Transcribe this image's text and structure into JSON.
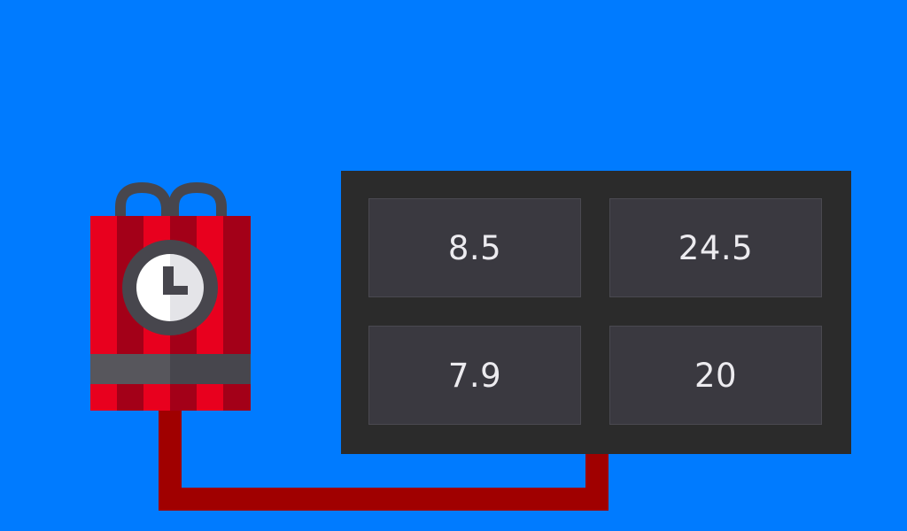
{
  "colors": {
    "background": "#007bff",
    "panel": "#2b2b2b",
    "button": "#3a3940",
    "button_text": "#ecebef",
    "wire": "#a00000",
    "dynamite_red": "#e8001e",
    "dynamite_dark_red": "#a30018",
    "band": "#47464d",
    "clock_face": "#f2f2f2"
  },
  "icons": {
    "bomb": "dynamite-timer-bomb-icon",
    "clock": "clock-icon"
  },
  "answers": [
    {
      "label": "8.5"
    },
    {
      "label": "24.5"
    },
    {
      "label": "7.9"
    },
    {
      "label": "20"
    }
  ]
}
